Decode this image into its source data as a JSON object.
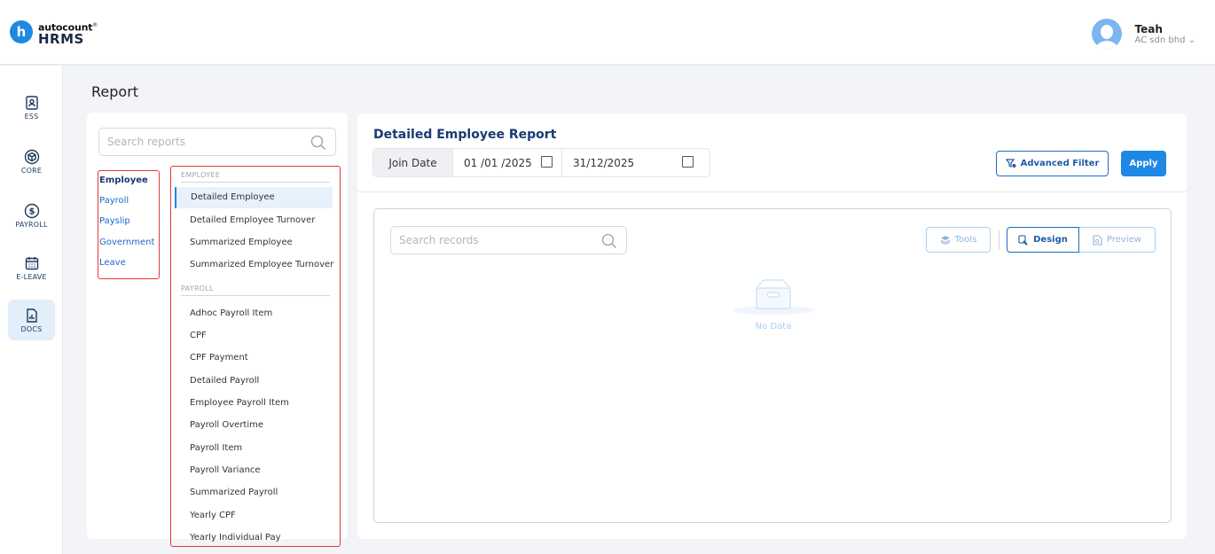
{
  "header": {
    "logo_circle": "h",
    "logo_top": "autocount",
    "logo_mark": "®",
    "logo_bottom": "HRMS",
    "user_name": "Teah",
    "user_company": "AC sdn bhd"
  },
  "sidebar": {
    "items": [
      {
        "label": "ESS",
        "icon": "id-badge-icon"
      },
      {
        "label": "CORE",
        "icon": "cube-icon"
      },
      {
        "label": "PAYROLL",
        "icon": "dollar-coin-icon"
      },
      {
        "label": "E-LEAVE",
        "icon": "calendar-icon"
      },
      {
        "label": "DOCS",
        "icon": "chart-document-icon"
      }
    ],
    "active": "DOCS"
  },
  "page": {
    "title": "Report"
  },
  "reports": {
    "search_placeholder": "Search reports",
    "categories": [
      "Employee",
      "Payroll",
      "Payslip",
      "Government",
      "Leave"
    ],
    "active_category": "Employee",
    "sections": [
      {
        "header": "EMPLOYEE",
        "items": [
          "Detailed Employee",
          "Detailed Employee Turnover",
          "Summarized Employee",
          "Summarized Employee Turnover"
        ]
      },
      {
        "header": "PAYROLL",
        "items": [
          "Adhoc Payroll Item",
          "CPF",
          "CPF Payment",
          "Detailed Payroll",
          "Employee Payroll Item",
          "Payroll Overtime",
          "Payroll Item",
          "Payroll Variance",
          "Summarized Payroll",
          "Yearly CPF",
          "Yearly Individual Pay"
        ]
      }
    ],
    "active_item": "Detailed Employee"
  },
  "detail": {
    "title": "Detailed Employee Report",
    "filter_label": "Join Date",
    "date_from": "01 /01 /2025",
    "date_to": "31/12/2025",
    "advanced_filter": "Advanced Filter",
    "apply": "Apply",
    "records_placeholder": "Search records",
    "tools": "Tools",
    "design": "Design",
    "preview": "Preview",
    "empty_text": "No Data"
  },
  "colors": {
    "primary": "#1e88e5",
    "title_navy": "#1a3a72",
    "highlight_red": "#e53935",
    "active_bg": "#e3eefb"
  }
}
